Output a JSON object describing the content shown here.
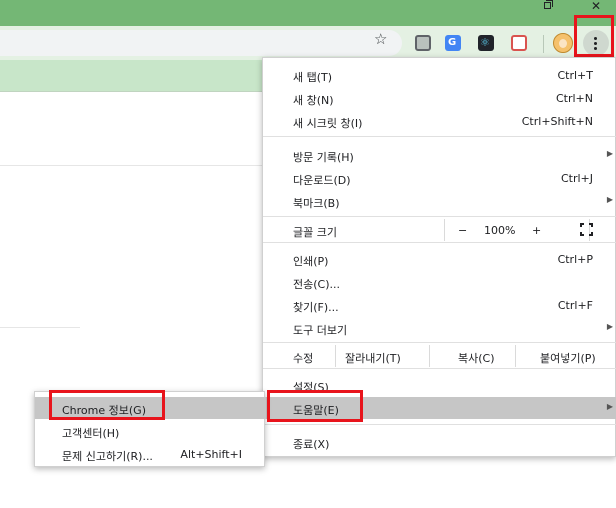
{
  "window_controls": {
    "restore_icon": "restore-icon",
    "close_glyph": "✕"
  },
  "toolbar": {
    "star_glyph": "☆",
    "extensions": [
      "ext-icon",
      "translate-icon",
      "react-devtools-icon",
      "extension-icon"
    ],
    "react_glyph": "⚛",
    "translate_glyph": "G",
    "menu_icon": "three-dots-vertical-icon"
  },
  "menu": {
    "items": [
      {
        "label": "새 탭(T)",
        "shortcut": "Ctrl+T"
      },
      {
        "label": "새 창(N)",
        "shortcut": "Ctrl+N"
      },
      {
        "label": "새 시크릿 창(I)",
        "shortcut": "Ctrl+Shift+N"
      },
      {
        "label": "방문 기록(H)",
        "shortcut": ""
      },
      {
        "label": "다운로드(D)",
        "shortcut": "Ctrl+J"
      },
      {
        "label": "북마크(B)",
        "shortcut": ""
      },
      {
        "label": "인쇄(P)",
        "shortcut": "Ctrl+P"
      },
      {
        "label": "전송(C)...",
        "shortcut": ""
      },
      {
        "label": "찾기(F)...",
        "shortcut": "Ctrl+F"
      },
      {
        "label": "도구 더보기",
        "shortcut": ""
      },
      {
        "label": "설정(S)",
        "shortcut": ""
      },
      {
        "label": "도움말(E)",
        "shortcut": ""
      },
      {
        "label": "종료(X)",
        "shortcut": ""
      }
    ],
    "zoom": {
      "label": "글꼴 크기",
      "minus": "−",
      "value": "100%",
      "plus": "+"
    },
    "edit": {
      "label": "수정",
      "cut": "잘라내기(T)",
      "copy": "복사(C)",
      "paste": "붙여넣기(P)"
    },
    "submenu_arrow": "▶"
  },
  "help_submenu": {
    "items": [
      {
        "label": "Chrome 정보(G)",
        "shortcut": ""
      },
      {
        "label": "고객센터(H)",
        "shortcut": ""
      },
      {
        "label": "문제 신고하기(R)...",
        "shortcut": "Alt+Shift+I"
      }
    ]
  },
  "colors": {
    "titlebar": "#74b775",
    "toolbar": "#e4f1e3",
    "highlight": "#e8141c",
    "menu_active": "#c6c6c6"
  }
}
